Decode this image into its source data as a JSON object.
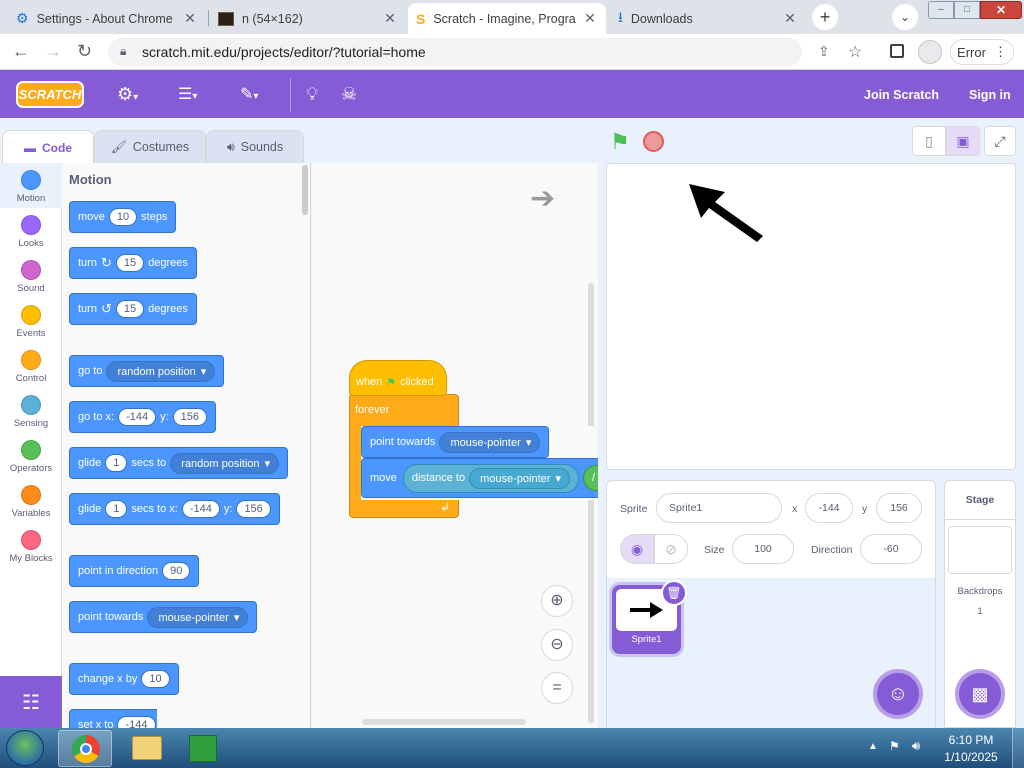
{
  "browser": {
    "tabs": [
      {
        "label": "Settings - About Chrome",
        "icon": "gear-icon"
      },
      {
        "label": "n (54×162)",
        "icon": "image-thumbnail-icon"
      },
      {
        "label": "Scratch - Imagine, Progra",
        "icon": "scratch-icon"
      },
      {
        "label": "Downloads",
        "icon": "download-icon"
      }
    ],
    "url": "scratch.mit.edu/projects/editor/?tutorial=home",
    "error_label": "Error"
  },
  "menubar": {
    "logo": "SCRATCH",
    "join": "Join Scratch",
    "signin": "Sign in"
  },
  "editor_tabs": [
    "Code",
    "Costumes",
    "Sounds"
  ],
  "categories": [
    {
      "label": "Motion",
      "color": "#4c97ff"
    },
    {
      "label": "Looks",
      "color": "#9966ff"
    },
    {
      "label": "Sound",
      "color": "#cf63cf"
    },
    {
      "label": "Events",
      "color": "#ffbf00"
    },
    {
      "label": "Control",
      "color": "#ffab19"
    },
    {
      "label": "Sensing",
      "color": "#5cb1d6"
    },
    {
      "label": "Operators",
      "color": "#59c059"
    },
    {
      "label": "Variables",
      "color": "#ff8c1a"
    },
    {
      "label": "My Blocks",
      "color": "#ff6680"
    }
  ],
  "palette": {
    "heading": "Motion",
    "move": {
      "a": "move",
      "v": "10",
      "b": "steps"
    },
    "turn_right": {
      "a": "turn",
      "v": "15",
      "b": "degrees"
    },
    "turn_left": {
      "a": "turn",
      "v": "15",
      "b": "degrees"
    },
    "goto": {
      "a": "go to",
      "d": "random position"
    },
    "gotoxy": {
      "a": "go to x:",
      "x": "-144",
      "b": "y:",
      "y": "156"
    },
    "glide": {
      "a": "glide",
      "v": "1",
      "b": "secs to",
      "d": "random position"
    },
    "glidexy": {
      "a": "glide",
      "v": "1",
      "b": "secs to x:",
      "x": "-144",
      "c": "y:",
      "y": "156"
    },
    "pointdir": {
      "a": "point in direction",
      "v": "90"
    },
    "pointtowards": {
      "a": "point towards",
      "d": "mouse-pointer"
    },
    "changex": {
      "a": "change x by",
      "v": "10"
    },
    "setx": {
      "a": "set x to",
      "v": "-144"
    }
  },
  "script": {
    "hat": {
      "a": "when",
      "b": "clicked"
    },
    "forever": "forever",
    "point": {
      "a": "point towards",
      "d": "mouse-pointer"
    },
    "move": {
      "a": "move",
      "b": "distance to",
      "d": "mouse-pointer",
      "c": "/"
    }
  },
  "sprite": {
    "sprite_label": "Sprite",
    "name": "Sprite1",
    "x_label": "x",
    "x": "-144",
    "y_label": "y",
    "y": "156",
    "size_label": "Size",
    "size": "100",
    "direction_label": "Direction",
    "direction": "-60",
    "thumb_name": "Sprite1"
  },
  "stage_panel": {
    "title": "Stage",
    "backdrops_label": "Backdrops",
    "backdrops_count": "1"
  },
  "taskbar": {
    "time": "6:10 PM",
    "date": "1/10/2025"
  }
}
